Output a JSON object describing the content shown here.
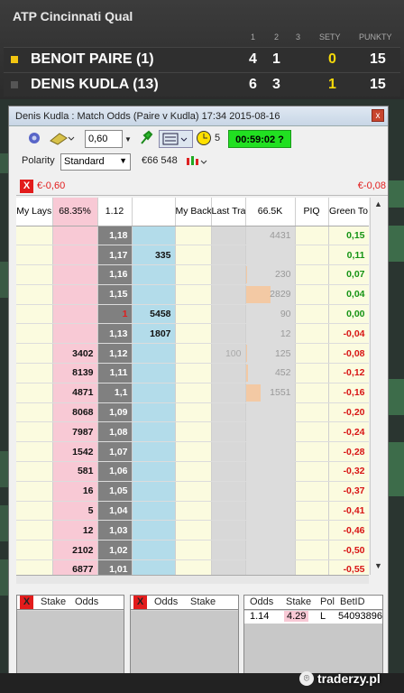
{
  "scoreboard": {
    "title": "ATP Cincinnati Qual",
    "col_headers": [
      "1",
      "2",
      "3",
      "SETY",
      "PUNKTY"
    ],
    "players": [
      {
        "name": "BENOIT PAIRE (1)",
        "s1": "4",
        "s2": "1",
        "sets": "0",
        "points": "15",
        "serving": true
      },
      {
        "name": "DENIS KUDLA (13)",
        "s1": "6",
        "s2": "3",
        "sets": "1",
        "points": "15",
        "serving": false
      }
    ]
  },
  "window": {
    "title": "Denis Kudla : Match Odds (Paire v Kudla) 17:34 2015-08-16",
    "close_label": "x"
  },
  "toolbar": {
    "stake_value": "0,60",
    "count_label": "5",
    "timer": "00:59:02 ?",
    "polarity_label": "Polarity",
    "polarity_value": "Standard",
    "matched_label": "€66 548"
  },
  "pl_bar": {
    "left_value": "€-0,60",
    "right_value": "€-0,08",
    "x_label": "X"
  },
  "ladder": {
    "headers": {
      "my_lays": "My Lays",
      "lay_pct": "68.35%",
      "ltp": "1.12",
      "back_pct": "",
      "my_backs": "My Backs",
      "last_trade": "Last Trade",
      "volume": "66.5K",
      "piq": "PIQ",
      "green": "Green To"
    },
    "rows": [
      {
        "lay": "",
        "price": "1,18",
        "back": "",
        "trade": "",
        "vol": "4431",
        "volfrac": 0.0,
        "green": "0,15"
      },
      {
        "lay": "",
        "price": "1,17",
        "back": "335",
        "trade": "",
        "vol": "",
        "volfrac": 0.0,
        "green": "0,11"
      },
      {
        "lay": "",
        "price": "1,16",
        "back": "",
        "trade": "",
        "vol": "230",
        "volfrac": 0.03,
        "green": "0,07"
      },
      {
        "lay": "",
        "price": "1,15",
        "back": "",
        "trade": "",
        "vol": "2829",
        "volfrac": 0.5,
        "green": "0,04"
      },
      {
        "lay": "",
        "price": "1",
        "back": "5458",
        "trade": "",
        "vol": "90",
        "volfrac": 0.0,
        "green": "0,00"
      },
      {
        "lay": "",
        "price": "1,13",
        "back": "1807",
        "trade": "",
        "vol": "12",
        "volfrac": 0.0,
        "green": "-0,04"
      },
      {
        "lay": "3402",
        "price": "1,12",
        "back": "",
        "trade": "100",
        "vol": "125",
        "volfrac": 0.03,
        "green": "-0,08"
      },
      {
        "lay": "8139",
        "price": "1,11",
        "back": "",
        "trade": "",
        "vol": "452",
        "volfrac": 0.05,
        "green": "-0,12"
      },
      {
        "lay": "4871",
        "price": "1,1",
        "back": "",
        "trade": "",
        "vol": "1551",
        "volfrac": 0.3,
        "green": "-0,16"
      },
      {
        "lay": "8068",
        "price": "1,09",
        "back": "",
        "trade": "",
        "vol": "",
        "volfrac": 0.0,
        "green": "-0,20"
      },
      {
        "lay": "7987",
        "price": "1,08",
        "back": "",
        "trade": "",
        "vol": "",
        "volfrac": 0.0,
        "green": "-0,24"
      },
      {
        "lay": "1542",
        "price": "1,07",
        "back": "",
        "trade": "",
        "vol": "",
        "volfrac": 0.0,
        "green": "-0,28"
      },
      {
        "lay": "581",
        "price": "1,06",
        "back": "",
        "trade": "",
        "vol": "",
        "volfrac": 0.0,
        "green": "-0,32"
      },
      {
        "lay": "16",
        "price": "1,05",
        "back": "",
        "trade": "",
        "vol": "",
        "volfrac": 0.0,
        "green": "-0,37"
      },
      {
        "lay": "5",
        "price": "1,04",
        "back": "",
        "trade": "",
        "vol": "",
        "volfrac": 0.0,
        "green": "-0,41"
      },
      {
        "lay": "12",
        "price": "1,03",
        "back": "",
        "trade": "",
        "vol": "",
        "volfrac": 0.0,
        "green": "-0,46"
      },
      {
        "lay": "2102",
        "price": "1,02",
        "back": "",
        "trade": "",
        "vol": "",
        "volfrac": 0.0,
        "green": "-0,50"
      },
      {
        "lay": "6877",
        "price": "1,01",
        "back": "",
        "trade": "",
        "vol": "",
        "volfrac": 0.0,
        "green": "-0,55"
      }
    ]
  },
  "orders": {
    "lay_panel": {
      "x": "X",
      "col1": "Stake",
      "col2": "Odds"
    },
    "back_panel": {
      "x": "X",
      "col1": "Odds",
      "col2": "Stake"
    },
    "matched_panel": {
      "cols": [
        "Odds",
        "Stake",
        "Pol",
        "BetID"
      ],
      "bet": {
        "odds": "1.14",
        "stake": "4.29",
        "pol": "L",
        "betid": "54093896"
      }
    }
  },
  "watermark": "traderzy.pl",
  "colors": {
    "lay": "#f8c9d5",
    "back": "#b3dcea",
    "timer": "#21e021",
    "neg": "#d81414",
    "pos": "#149414"
  }
}
